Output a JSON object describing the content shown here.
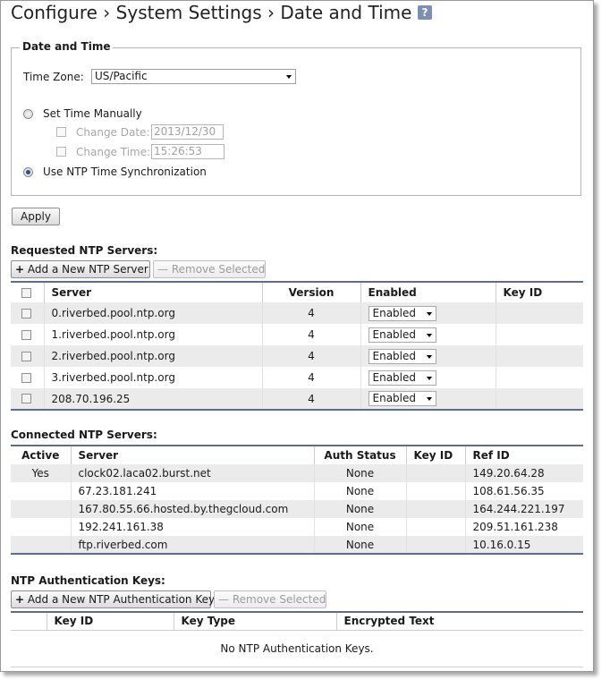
{
  "header": {
    "breadcrumb": [
      {
        "label": "Configure"
      },
      {
        "label": "System Settings"
      },
      {
        "label": "Date and Time"
      }
    ],
    "separator": "›",
    "help_icon": "?"
  },
  "date_time": {
    "legend": "Date and Time",
    "timezone_label": "Time Zone:",
    "timezone_value": "US/Pacific",
    "set_manual_label": "Set Time Manually",
    "change_date_label": "Change Date:",
    "change_date_value": "2013/12/30",
    "change_time_label": "Change Time:",
    "change_time_value": "15:26:53",
    "ntp_sync_label": "Use NTP Time Synchronization",
    "selected_mode": "ntp",
    "apply_label": "Apply"
  },
  "requested": {
    "title": "Requested NTP Servers:",
    "add_button": "Add a New NTP Server",
    "remove_button": "Remove Selected",
    "columns": {
      "server": "Server",
      "version": "Version",
      "enabled": "Enabled",
      "key_id": "Key ID"
    },
    "rows": [
      {
        "server": "0.riverbed.pool.ntp.org",
        "version": "4",
        "enabled": "Enabled",
        "key_id": ""
      },
      {
        "server": "1.riverbed.pool.ntp.org",
        "version": "4",
        "enabled": "Enabled",
        "key_id": ""
      },
      {
        "server": "2.riverbed.pool.ntp.org",
        "version": "4",
        "enabled": "Enabled",
        "key_id": ""
      },
      {
        "server": "3.riverbed.pool.ntp.org",
        "version": "4",
        "enabled": "Enabled",
        "key_id": ""
      },
      {
        "server": "208.70.196.25",
        "version": "4",
        "enabled": "Enabled",
        "key_id": ""
      }
    ]
  },
  "connected": {
    "title": "Connected NTP Servers:",
    "columns": {
      "active": "Active",
      "server": "Server",
      "auth_status": "Auth Status",
      "key_id": "Key ID",
      "ref_id": "Ref ID"
    },
    "rows": [
      {
        "active": "Yes",
        "server": "clock02.laca02.burst.net",
        "auth_status": "None",
        "key_id": "",
        "ref_id": "149.20.64.28"
      },
      {
        "active": "",
        "server": "67.23.181.241",
        "auth_status": "None",
        "key_id": "",
        "ref_id": "108.61.56.35"
      },
      {
        "active": "",
        "server": "167.80.55.66.hosted.by.thegcloud.com",
        "auth_status": "None",
        "key_id": "",
        "ref_id": "164.244.221.197"
      },
      {
        "active": "",
        "server": "192.241.161.38",
        "auth_status": "None",
        "key_id": "",
        "ref_id": "209.51.161.238"
      },
      {
        "active": "",
        "server": "ftp.riverbed.com",
        "auth_status": "None",
        "key_id": "",
        "ref_id": "10.16.0.15"
      }
    ]
  },
  "auth_keys": {
    "title": "NTP Authentication Keys:",
    "add_button": "Add a New NTP Authentication Key",
    "remove_button": "Remove Selected",
    "columns": {
      "key_id": "Key ID",
      "key_type": "Key Type",
      "encrypted_text": "Encrypted Text"
    },
    "empty_message": "No NTP Authentication Keys."
  }
}
